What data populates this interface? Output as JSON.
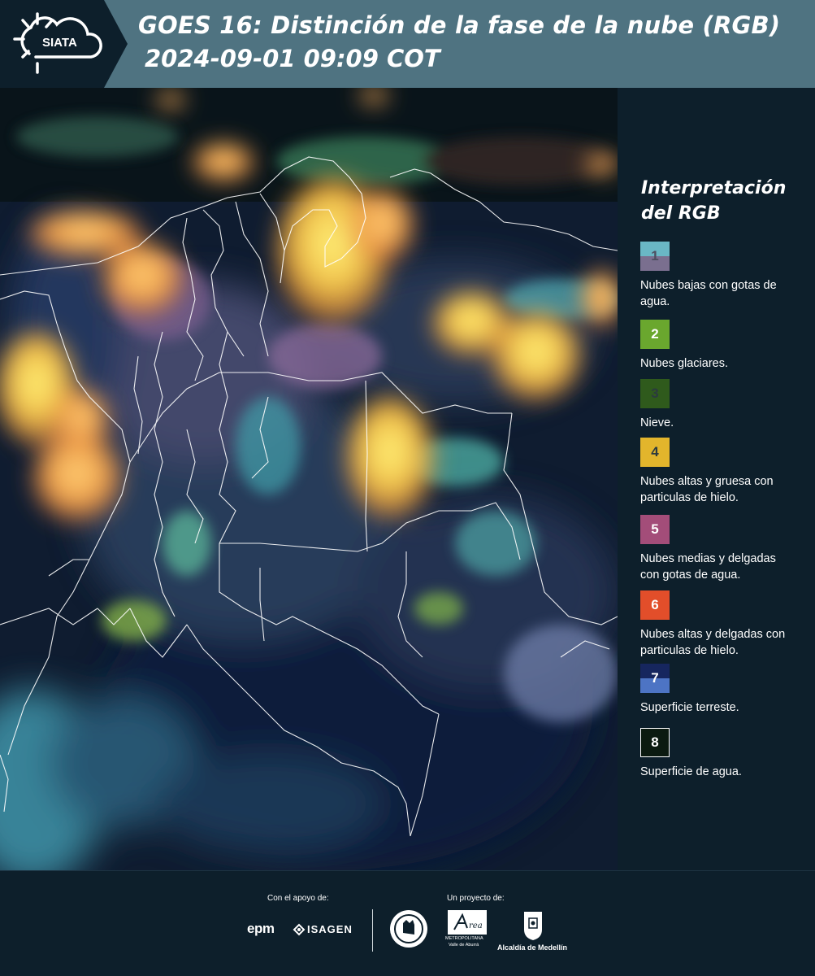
{
  "header": {
    "logo_text": "SIATA",
    "title_line1": "GOES 16: Distinción de la fase de la nube (RGB)",
    "title_line2": "2024-09-01 09:09 COT"
  },
  "legend": {
    "title": "Interpretación del RGB",
    "items": [
      {
        "number": "1",
        "color_top": "#6ab7c5",
        "color_bottom": "#7a6f8f",
        "label": "Nubes bajas con gotas de agua."
      },
      {
        "number": "2",
        "color_top": "#6aa72e",
        "color_bottom": "#6aa72e",
        "label": "Nubes glaciares."
      },
      {
        "number": "3",
        "color_top": "#2f5a1c",
        "color_bottom": "#2f5a1c",
        "label": "Nieve."
      },
      {
        "number": "4",
        "color_top": "#e2b52c",
        "color_bottom": "#e2b52c",
        "label": "Nubes altas y gruesa con particulas de hielo."
      },
      {
        "number": "5",
        "color_top": "#a34d79",
        "color_bottom": "#a34d79",
        "label": "Nubes medias y delgadas con gotas de agua."
      },
      {
        "number": "6",
        "color_top": "#e24e2a",
        "color_bottom": "#e24e2a",
        "label": "Nubes altas y delgadas con particulas de hielo."
      },
      {
        "number": "7",
        "color_top": "#16265e",
        "color_bottom": "#4d74c4",
        "label": "Superficie terreste."
      },
      {
        "number": "8",
        "color_top": "#0b1a10",
        "color_bottom": "#0b1a10",
        "label": "Superficie de agua."
      }
    ]
  },
  "footer": {
    "support_caption": "Con el apoyo de:",
    "project_caption": "Un proyecto de:",
    "sponsor_1": "epm",
    "sponsor_2": "ISAGEN",
    "partner_area_line1": "METROPOLITANA",
    "partner_area_line2": "Valle de Aburrá",
    "partner_alcaldia": "Alcaldía de Medellín"
  }
}
